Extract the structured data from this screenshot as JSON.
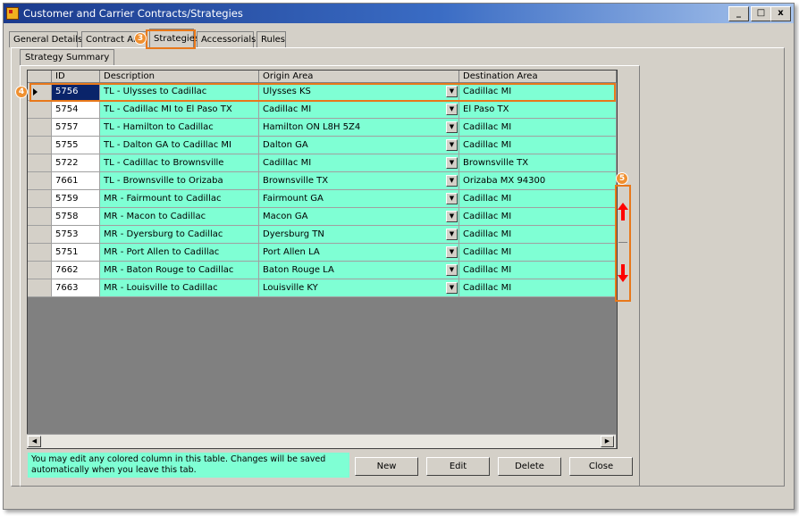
{
  "window": {
    "title": "Customer and Carrier Contracts/Strategies",
    "minimize": "_",
    "maximize": "□",
    "close": "x"
  },
  "tabs": [
    "General Details",
    "Contract Are",
    "Strategies",
    "Accessorials",
    "Rules"
  ],
  "subtab": "Strategy Summary",
  "grid": {
    "columns": [
      "ID",
      "Description",
      "Origin Area",
      "Destination Area"
    ],
    "rows": [
      {
        "id": "5756",
        "description": "TL - Ulysses to Cadillac",
        "origin": "Ulysses KS",
        "destination": "Cadillac MI"
      },
      {
        "id": "5754",
        "description": "TL - Cadillac MI to El Paso TX",
        "origin": "Cadillac MI",
        "destination": "El Paso TX"
      },
      {
        "id": "5757",
        "description": "TL - Hamilton to Cadillac",
        "origin": "Hamilton ON L8H 5Z4",
        "destination": "Cadillac MI"
      },
      {
        "id": "5755",
        "description": "TL - Dalton GA to Cadillac MI",
        "origin": "Dalton GA",
        "destination": "Cadillac MI"
      },
      {
        "id": "5722",
        "description": "TL - Cadillac to Brownsville",
        "origin": "Cadillac MI",
        "destination": "Brownsville TX"
      },
      {
        "id": "7661",
        "description": "TL - Brownsville to Orizaba",
        "origin": "Brownsville TX",
        "destination": "Orizaba MX 94300"
      },
      {
        "id": "5759",
        "description": "MR - Fairmount to Cadillac",
        "origin": "Fairmount GA",
        "destination": "Cadillac MI"
      },
      {
        "id": "5758",
        "description": "MR - Macon to Cadillac",
        "origin": "Macon GA",
        "destination": "Cadillac MI"
      },
      {
        "id": "5753",
        "description": "MR - Dyersburg to Cadillac",
        "origin": "Dyersburg TN",
        "destination": "Cadillac MI"
      },
      {
        "id": "5751",
        "description": "MR - Port Allen to Cadillac",
        "origin": "Port Allen LA",
        "destination": "Cadillac MI"
      },
      {
        "id": "7662",
        "description": "MR - Baton Rouge to Cadillac",
        "origin": "Baton Rouge LA",
        "destination": "Cadillac MI"
      },
      {
        "id": "7663",
        "description": "MR - Louisville to Cadillac",
        "origin": "Louisville KY",
        "destination": "Cadillac MI"
      }
    ],
    "selected_row": 0
  },
  "note": "You may edit any colored column in this table. Changes will be saved automatically when you leave this tab.",
  "buttons": {
    "new": "New",
    "edit": "Edit",
    "delete": "Delete",
    "close": "Close"
  },
  "markers": {
    "tab": "3",
    "row": "4",
    "scroll": "5"
  },
  "colors": {
    "editable": "#7fffd4",
    "highlight": "#e8781a",
    "selection": "#0a246a",
    "arrow": "#ff0000"
  }
}
